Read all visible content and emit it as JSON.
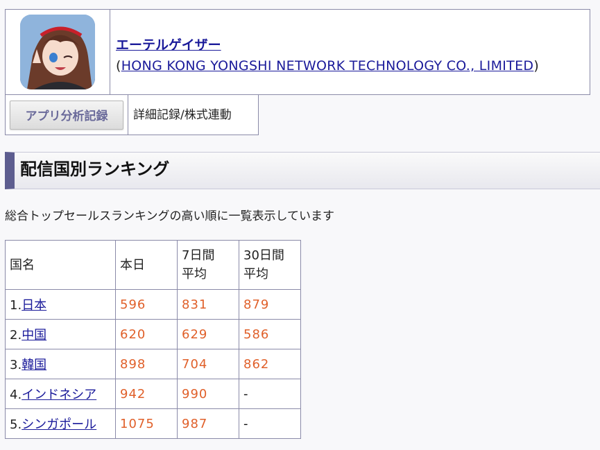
{
  "app": {
    "title": "エーテルゲイザー",
    "developer_open": "(",
    "developer": "HONG KONG YONGSHI NETWORK TECHNOLOGY CO., LIMITED",
    "developer_close": ")"
  },
  "actions": {
    "analysis_button": "アプリ分析記録",
    "detail_text": "詳細記録/株式連動"
  },
  "section": {
    "title": "配信国別ランキング",
    "description": "総合トップセールスランキングの高い順に一覧表示しています"
  },
  "table": {
    "headers": {
      "country": "国名",
      "today": "本日",
      "week_line1": "7日間",
      "week_line2": "平均",
      "month_line1": "30日間",
      "month_line2": "平均"
    },
    "rows": [
      {
        "rank": "1.",
        "country": "日本",
        "today": "596",
        "week": "831",
        "month": "879"
      },
      {
        "rank": "2.",
        "country": "中国",
        "today": "620",
        "week": "629",
        "month": "586"
      },
      {
        "rank": "3.",
        "country": "韓国",
        "today": "898",
        "week": "704",
        "month": "862"
      },
      {
        "rank": "4.",
        "country": "インドネシア",
        "today": "942",
        "week": "990",
        "month": "-"
      },
      {
        "rank": "5.",
        "country": "シンガポール",
        "today": "1075",
        "week": "987",
        "month": "-"
      }
    ]
  },
  "colors": {
    "accent_bar": "#5d5d8f",
    "rank_value": "#e0602a",
    "link": "#1a1a9a"
  },
  "icons": {
    "app_icon": "anime-character-app-icon"
  }
}
